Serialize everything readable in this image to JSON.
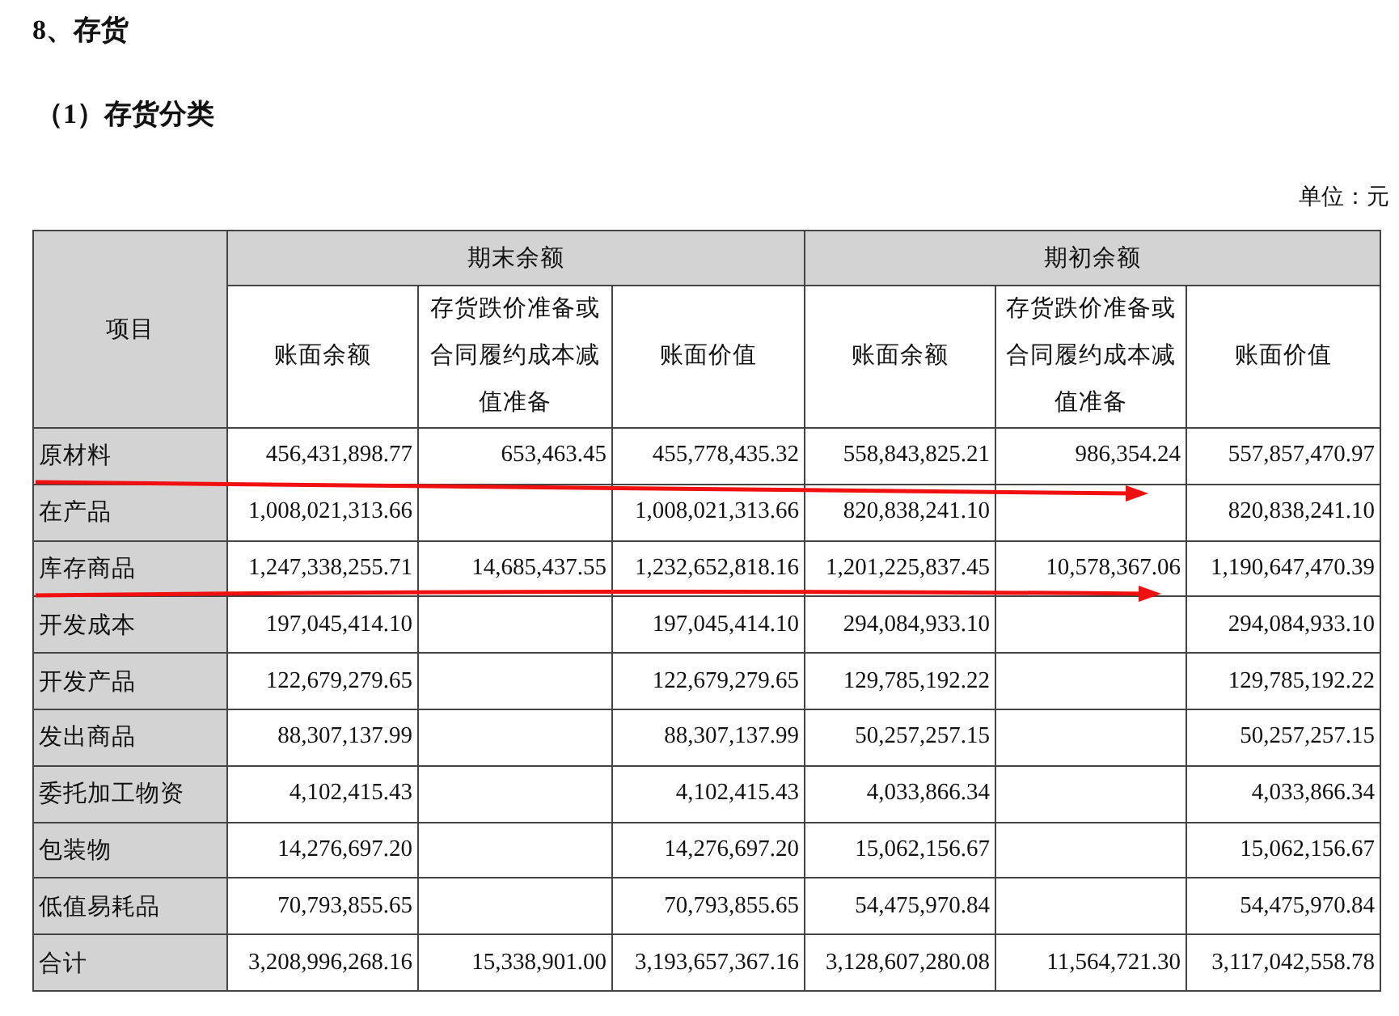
{
  "section_title": "8、存货",
  "subsection_title": "（1）存货分类",
  "unit_note": "单位：元",
  "table": {
    "item_header": "项目",
    "groups": [
      {
        "label": "期末余额",
        "columns": [
          "账面余额",
          "存货跌价准备或合同履约成本减值准备",
          "账面价值"
        ]
      },
      {
        "label": "期初余额",
        "columns": [
          "账面余额",
          "存货跌价准备或合同履约成本减值准备",
          "账面价值"
        ]
      }
    ],
    "rows": [
      {
        "item": "原材料",
        "closing": {
          "balance": "456,431,898.77",
          "provision": "653,463.45",
          "value": "455,778,435.32"
        },
        "opening": {
          "balance": "558,843,825.21",
          "provision": "986,354.24",
          "value": "557,857,470.97"
        }
      },
      {
        "item": "在产品",
        "closing": {
          "balance": "1,008,021,313.66",
          "value": "1,008,021,313.66"
        },
        "opening": {
          "balance": "820,838,241.10",
          "value": "820,838,241.10"
        }
      },
      {
        "item": "库存商品",
        "closing": {
          "balance": "1,247,338,255.71",
          "provision": "14,685,437.55",
          "value": "1,232,652,818.16"
        },
        "opening": {
          "balance": "1,201,225,837.45",
          "provision": "10,578,367.06",
          "value": "1,190,647,470.39"
        }
      },
      {
        "item": "开发成本",
        "closing": {
          "balance": "197,045,414.10",
          "value": "197,045,414.10"
        },
        "opening": {
          "balance": "294,084,933.10",
          "value": "294,084,933.10"
        }
      },
      {
        "item": "开发产品",
        "closing": {
          "balance": "122,679,279.65",
          "value": "122,679,279.65"
        },
        "opening": {
          "balance": "129,785,192.22",
          "value": "129,785,192.22"
        }
      },
      {
        "item": "发出商品",
        "closing": {
          "balance": "88,307,137.99",
          "value": "88,307,137.99"
        },
        "opening": {
          "balance": "50,257,257.15",
          "value": "50,257,257.15"
        }
      },
      {
        "item": "委托加工物资",
        "closing": {
          "balance": "4,102,415.43",
          "value": "4,102,415.43"
        },
        "opening": {
          "balance": "4,033,866.34",
          "value": "4,033,866.34"
        }
      },
      {
        "item": "包装物",
        "closing": {
          "balance": "14,276,697.20",
          "value": "14,276,697.20"
        },
        "opening": {
          "balance": "15,062,156.67",
          "value": "15,062,156.67"
        }
      },
      {
        "item": "低值易耗品",
        "closing": {
          "balance": "70,793,855.65",
          "value": "70,793,855.65"
        },
        "opening": {
          "balance": "54,475,970.84",
          "value": "54,475,970.84"
        }
      },
      {
        "item": "合计",
        "closing": {
          "balance": "3,208,996,268.16",
          "provision": "15,338,901.00",
          "value": "3,193,657,367.16"
        },
        "opening": {
          "balance": "3,128,607,280.08",
          "provision": "11,564,721.30",
          "value": "3,117,042,558.78"
        }
      }
    ]
  }
}
